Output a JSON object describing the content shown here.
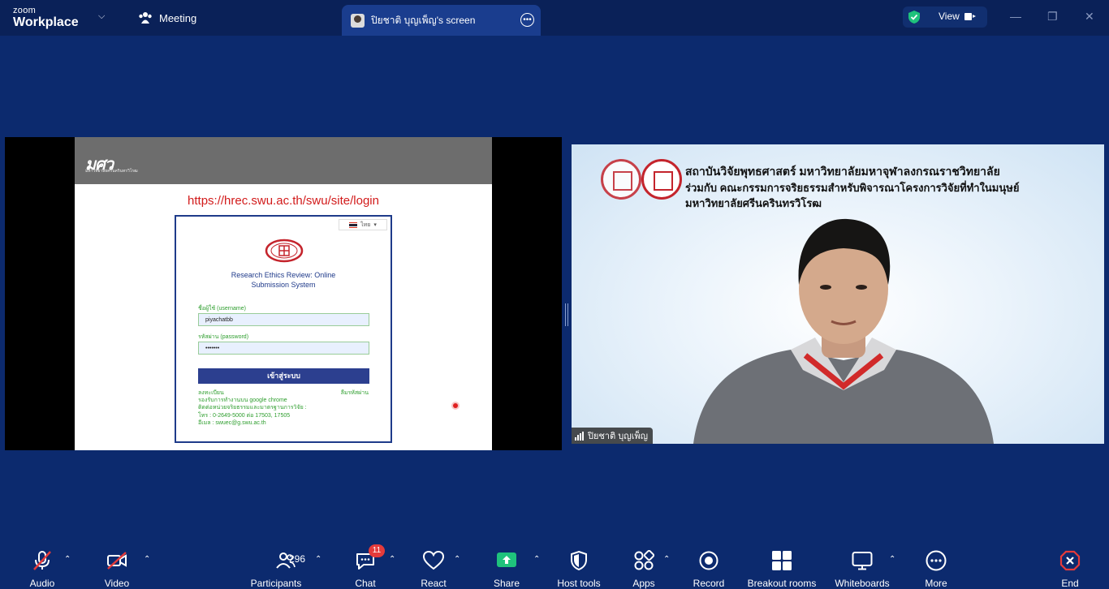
{
  "app": {
    "brand_top": "zoom",
    "brand_bottom": "Workplace"
  },
  "header": {
    "meeting_label": "Meeting",
    "share_tab_label": "ปิยชาติ  บุญเพ็ญ's screen",
    "view_label": "View"
  },
  "shared_screen": {
    "site_logo": "มศว",
    "site_logo_sub": "มหาวิทยาลัยศรีนครินทรวิโรฒ",
    "url": "https://hrec.swu.ac.th/swu/site/login",
    "language": "ไทย",
    "system_title_1": "Research Ethics Review: Online",
    "system_title_2": "Submission System",
    "username_label": "ชื่อผู้ใช้ (username)",
    "username_value": "piyachatbb",
    "password_label": "รหัสผ่าน (password)",
    "password_value": "•••••••",
    "login_button": "เข้าสู่ระบบ",
    "register_link": "ลงทะเบียน",
    "forgot_link": "ลืมรหัสผ่าน",
    "note_1": "รองรับการทำงานบน google chrome",
    "note_2": "ติดต่อหน่วยจริยธรรมและมาตรฐานการวิจัย :",
    "note_3": "โทร : 0-2649-5000 ต่อ 17503, 17505",
    "note_4": "อีเมล : swuec@g.swu.ac.th"
  },
  "camera": {
    "header_line_1": "สถาบันวิจัยพุทธศาสตร์ มหาวิทยาลัยมหาจุฬาลงกรณราชวิทยาลัย",
    "header_line_2": "ร่วมกับ คณะกรรมการจริยธรรมสำหรับพิจารณาโครงการวิจัยที่ทำในมนุษย์",
    "header_line_3": "มหาวิทยาลัยศรีนครินทรวิโรฒ",
    "participant_name": "ปิยชาติ  บุญเพ็ญ"
  },
  "toolbar": {
    "audio": "Audio",
    "video": "Video",
    "participants": "Participants",
    "participants_count": "296",
    "chat": "Chat",
    "chat_badge": "11",
    "react": "React",
    "share": "Share",
    "host_tools": "Host tools",
    "apps": "Apps",
    "record": "Record",
    "breakout_rooms": "Breakout rooms",
    "whiteboards": "Whiteboards",
    "more": "More",
    "end": "End"
  },
  "colors": {
    "background": "#0c2a6e",
    "topbar": "#0a2158",
    "share_green": "#1fc27c",
    "end_red": "#e53b3b",
    "login_blue": "#2c3f8f"
  }
}
